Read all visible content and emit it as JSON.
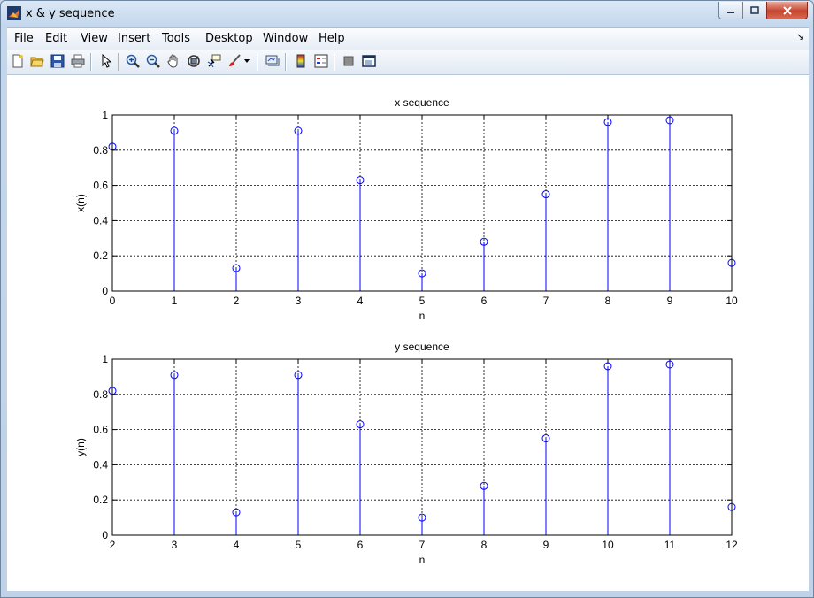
{
  "window": {
    "title": "x & y sequence"
  },
  "menu": [
    "File",
    "Edit",
    "View",
    "Insert",
    "Tools",
    "Desktop",
    "Window",
    "Help"
  ],
  "toolbar": {
    "icons": [
      "new-figure-icon",
      "open-file-icon",
      "save-figure-icon",
      "print-figure-icon",
      "edit-plot-arrow-icon",
      "zoom-in-icon",
      "zoom-out-icon",
      "pan-hand-icon",
      "rotate-3d-icon",
      "data-cursor-icon",
      "brush-icon",
      "brush-dropdown-icon",
      "link-plot-icon",
      "insert-colorbar-icon",
      "insert-legend-icon",
      "hide-plot-tools-icon",
      "show-plot-tools-icon"
    ]
  },
  "colors": {
    "stem": "#0000ff",
    "grid": "#000000",
    "axes": "#000000"
  },
  "chart_data": [
    {
      "type": "stem",
      "title": "x sequence",
      "xlabel": "n",
      "ylabel": "x(n)",
      "x": [
        0,
        1,
        2,
        3,
        4,
        5,
        6,
        7,
        8,
        9,
        10
      ],
      "values": [
        0.82,
        0.91,
        0.13,
        0.91,
        0.63,
        0.1,
        0.28,
        0.55,
        0.96,
        0.97,
        0.16
      ],
      "xlim": [
        0,
        10
      ],
      "ylim": [
        0,
        1
      ],
      "xticks": [
        "0",
        "1",
        "2",
        "3",
        "4",
        "5",
        "6",
        "7",
        "8",
        "9",
        "10"
      ],
      "yticks": [
        "0",
        "0.2",
        "0.4",
        "0.6",
        "0.8",
        "1"
      ],
      "grid": true,
      "marker": "open-circle"
    },
    {
      "type": "stem",
      "title": "y sequence",
      "xlabel": "n",
      "ylabel": "y(n)",
      "x": [
        2,
        3,
        4,
        5,
        6,
        7,
        8,
        9,
        10,
        11,
        12
      ],
      "values": [
        0.82,
        0.91,
        0.13,
        0.91,
        0.63,
        0.1,
        0.28,
        0.55,
        0.96,
        0.97,
        0.16
      ],
      "xlim": [
        2,
        12
      ],
      "ylim": [
        0,
        1
      ],
      "xticks": [
        "2",
        "3",
        "4",
        "5",
        "6",
        "7",
        "8",
        "9",
        "10",
        "11",
        "12"
      ],
      "yticks": [
        "0",
        "0.2",
        "0.4",
        "0.6",
        "0.8",
        "1"
      ],
      "grid": true,
      "marker": "open-circle"
    }
  ]
}
